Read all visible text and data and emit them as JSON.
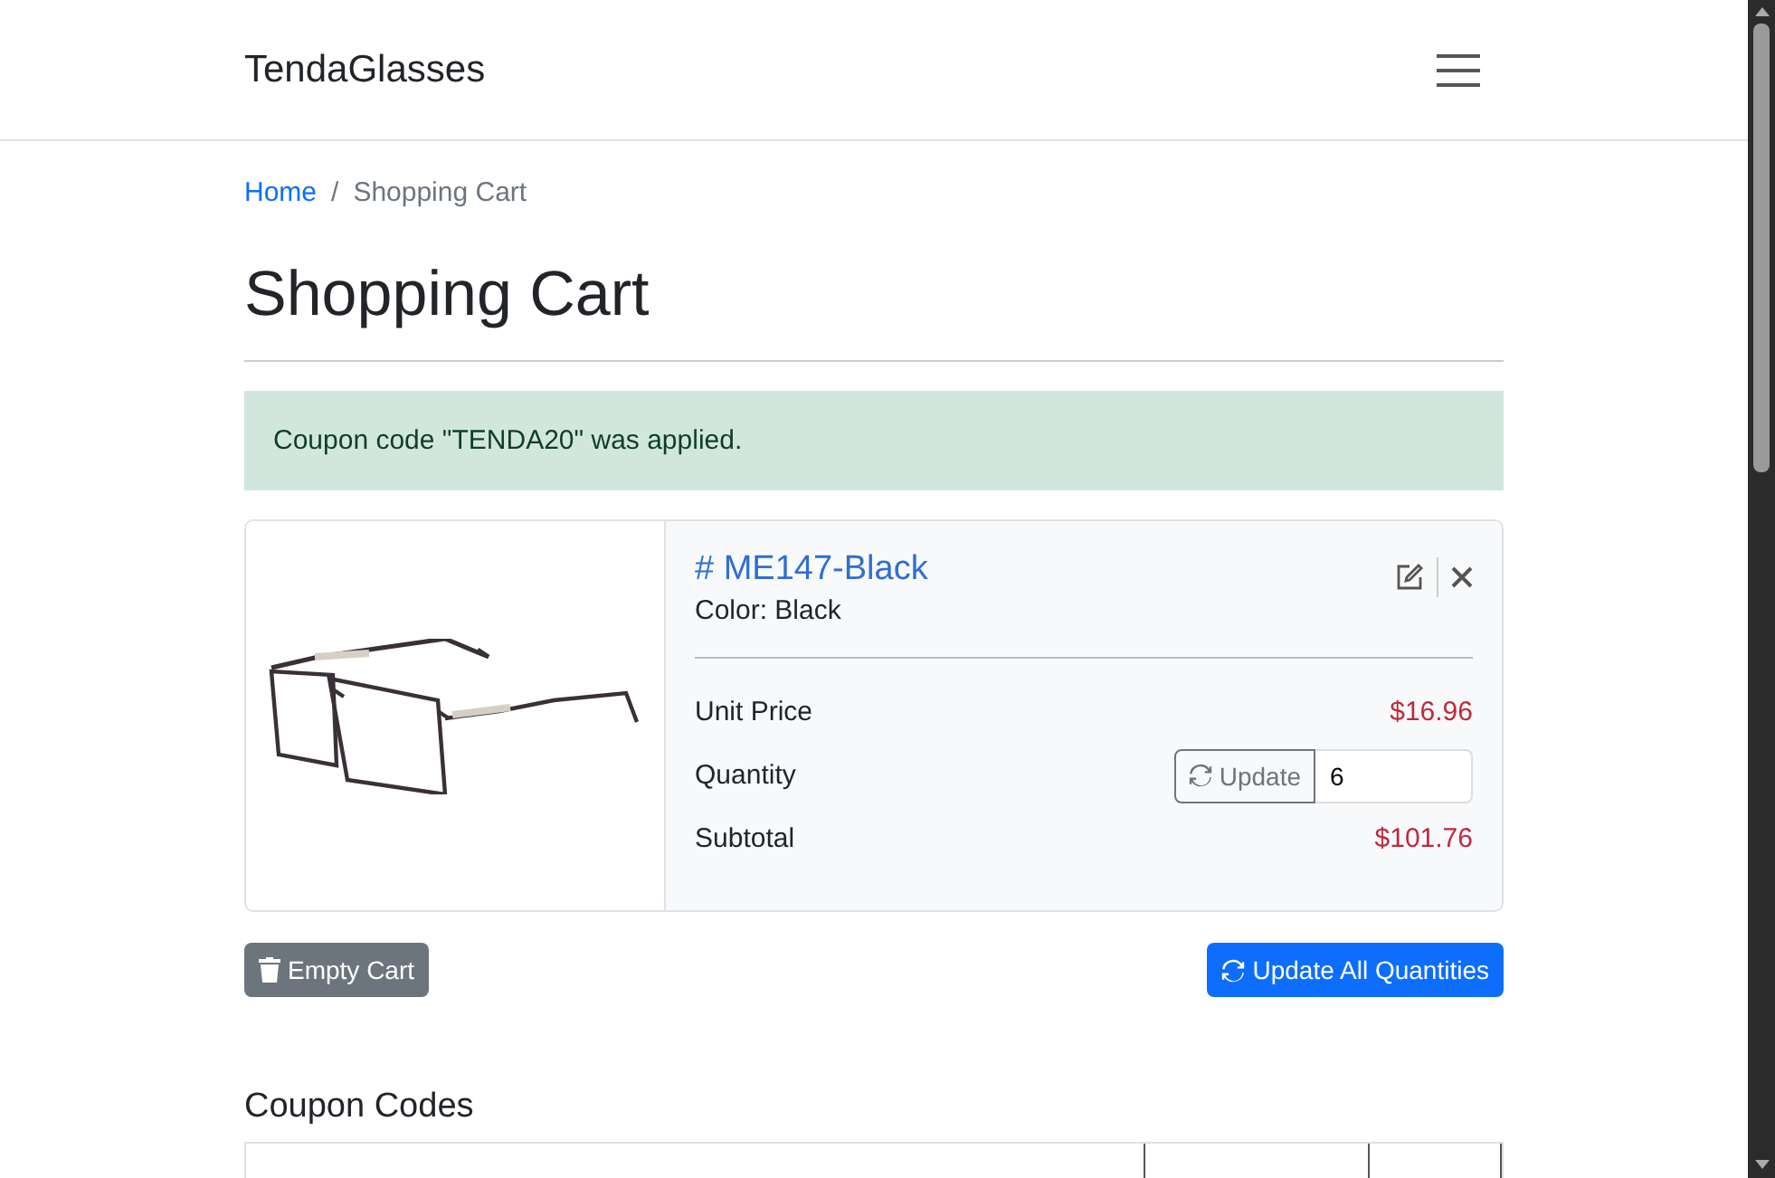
{
  "navbar": {
    "brand": "TendaGlasses"
  },
  "breadcrumb_separator": "/",
  "breadcrumb": [
    {
      "label": "Home",
      "link": true
    },
    {
      "label": "Shopping Cart",
      "link": false
    }
  ],
  "page_title": "Shopping Cart",
  "alert": {
    "text": "Coupon code \"TENDA20\" was applied."
  },
  "cart_items": [
    {
      "title": "# ME147-Black",
      "color_label": "Color: Black",
      "unit_price_label": "Unit Price",
      "unit_price": "$16.96",
      "quantity_label": "Quantity",
      "update_button": "Update",
      "quantity": "6",
      "subtotal_label": "Subtotal",
      "subtotal": "$101.76"
    }
  ],
  "buttons": {
    "empty_cart": "Empty Cart",
    "update_all": "Update All Quantities"
  },
  "coupon_section": {
    "title": "Coupon Codes"
  }
}
